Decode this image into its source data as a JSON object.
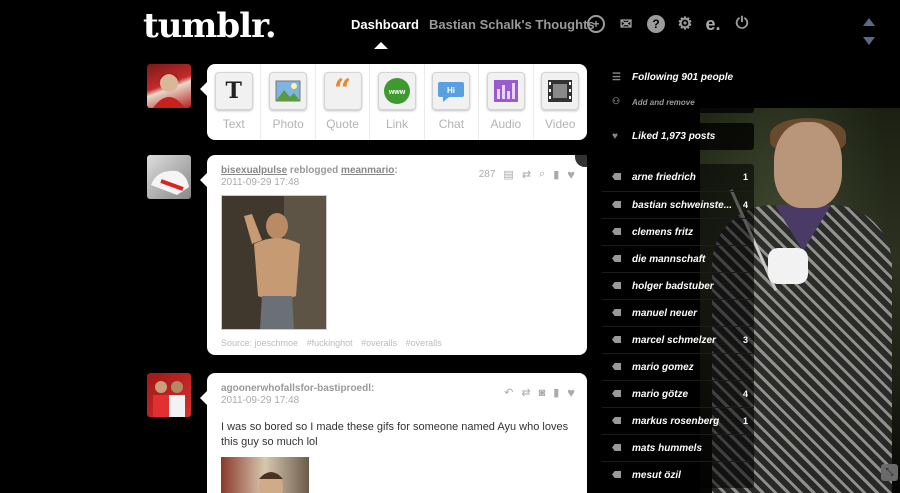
{
  "header": {
    "logo": "tumblr.",
    "nav": [
      {
        "label": "Dashboard",
        "active": true
      },
      {
        "label": "Bastian Schalk's Thoughts",
        "active": false
      }
    ],
    "icons": [
      "plus-circle-icon",
      "mail-icon",
      "help-icon",
      "gear-icon",
      "edit-icon",
      "power-icon"
    ]
  },
  "post_types": [
    {
      "label": "Text",
      "icon": "text-icon"
    },
    {
      "label": "Photo",
      "icon": "photo-icon"
    },
    {
      "label": "Quote",
      "icon": "quote-icon"
    },
    {
      "label": "Link",
      "icon": "link-icon"
    },
    {
      "label": "Chat",
      "icon": "chat-icon"
    },
    {
      "label": "Audio",
      "icon": "audio-icon"
    },
    {
      "label": "Video",
      "icon": "video-icon"
    }
  ],
  "posts": [
    {
      "user": "bisexualpulse",
      "action": "reblogged",
      "source_user": "meanmario",
      "date": "2011-09-29 17:48",
      "notes": "287",
      "tags": [
        "Source: joeschmoe",
        "#fuckinghot",
        "#overalls",
        "#overalls"
      ]
    },
    {
      "user": "agoonerwhofallsfor-bastiproedl:",
      "date": "2011-09-29 17:48",
      "body": "I was so bored so I made these gifs for someone named Ayu who loves this guy so much lol"
    }
  ],
  "sidebar": {
    "following": "Following 901 people",
    "add_remove": "Add and remove",
    "liked": "Liked 1,973 posts",
    "tags": [
      {
        "name": "arne friedrich",
        "count": "1"
      },
      {
        "name": "bastian schweinste...",
        "count": "4"
      },
      {
        "name": "clemens fritz",
        "count": ""
      },
      {
        "name": "die mannschaft",
        "count": ""
      },
      {
        "name": "holger badstuber",
        "count": ""
      },
      {
        "name": "manuel neuer",
        "count": ""
      },
      {
        "name": "marcel schmelzer",
        "count": "3"
      },
      {
        "name": "mario gomez",
        "count": ""
      },
      {
        "name": "mario götze",
        "count": "4"
      },
      {
        "name": "markus rosenberg",
        "count": "1"
      },
      {
        "name": "mats hummels",
        "count": ""
      },
      {
        "name": "mesut özil",
        "count": ""
      }
    ]
  },
  "colors": {
    "background": "#000000",
    "panel": "#ffffff",
    "nav_dim": "#9a9a9a"
  }
}
